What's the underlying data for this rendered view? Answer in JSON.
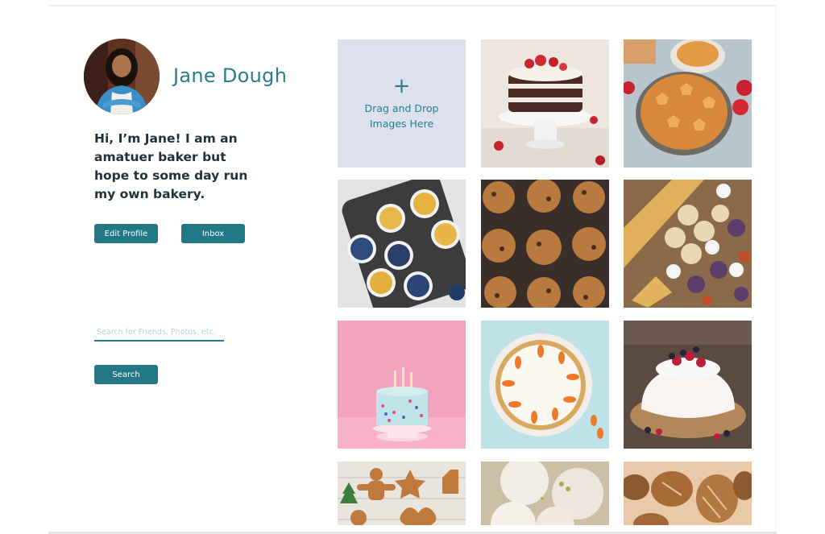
{
  "profile": {
    "name": "Jane Dough",
    "bio": "Hi, I’m Jane! I am an amatuer baker but hope to some day run my own bakery."
  },
  "actions": {
    "edit_profile": "Edit Profile",
    "inbox": "Inbox"
  },
  "search": {
    "placeholder": "Search for Friends, Photos, etc.",
    "value": "",
    "button": "Search"
  },
  "upload": {
    "icon": "plus-icon",
    "line1": "Drag and Drop",
    "line2": "Images Here"
  },
  "gallery": [
    "layer-cake-photo",
    "pie-photo",
    "blueberry-muffins-photo",
    "cookies-photo",
    "pastry-platter-photo",
    "birthday-cake-photo",
    "carrot-cake-photo",
    "berry-cake-photo",
    "gingerbread-cookies-photo",
    "snowball-cookies-photo",
    "bread-loaves-photo"
  ],
  "colors": {
    "accent": "#237888",
    "name_text": "#2a7d8c",
    "dropzone_bg": "#dde1ed"
  }
}
